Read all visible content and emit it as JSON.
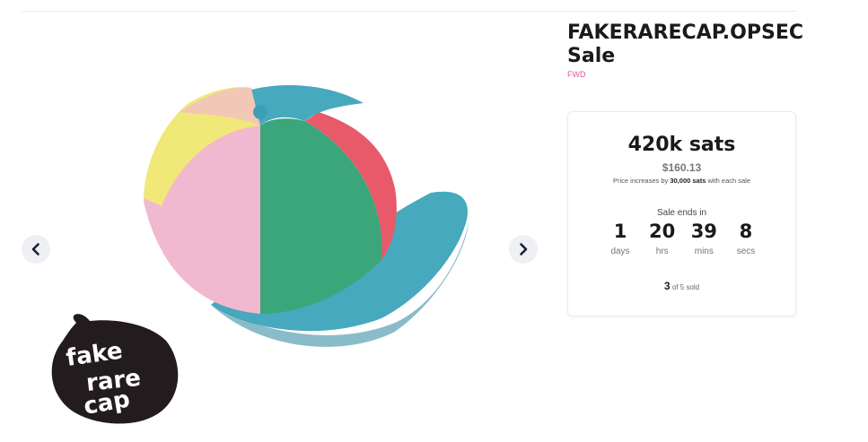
{
  "product": {
    "title": "FAKERARECAP.OPSEC Sale",
    "tag": "FWD"
  },
  "carousel": {
    "prev_icon": "chevron-left-icon",
    "next_icon": "chevron-right-icon",
    "logo": {
      "line1": "fake",
      "line2": "rare",
      "line3": "cap"
    }
  },
  "sale": {
    "price": "420k sats",
    "usd": "$160.13",
    "increase_prefix": "Price increases by ",
    "increase_amount": "30,000 sats",
    "increase_suffix": " with each sale",
    "ends_label": "Sale ends in",
    "countdown": [
      {
        "value": "1",
        "label": "days"
      },
      {
        "value": "20",
        "label": "hrs"
      },
      {
        "value": "39",
        "label": "mins"
      },
      {
        "value": "8",
        "label": "secs"
      }
    ],
    "sold_count": "3",
    "sold_suffix": " of 5 sold"
  },
  "colors": {
    "tag": "#e056a0",
    "text": "#1a1a1a",
    "nav_bg": "#eef0f4"
  }
}
